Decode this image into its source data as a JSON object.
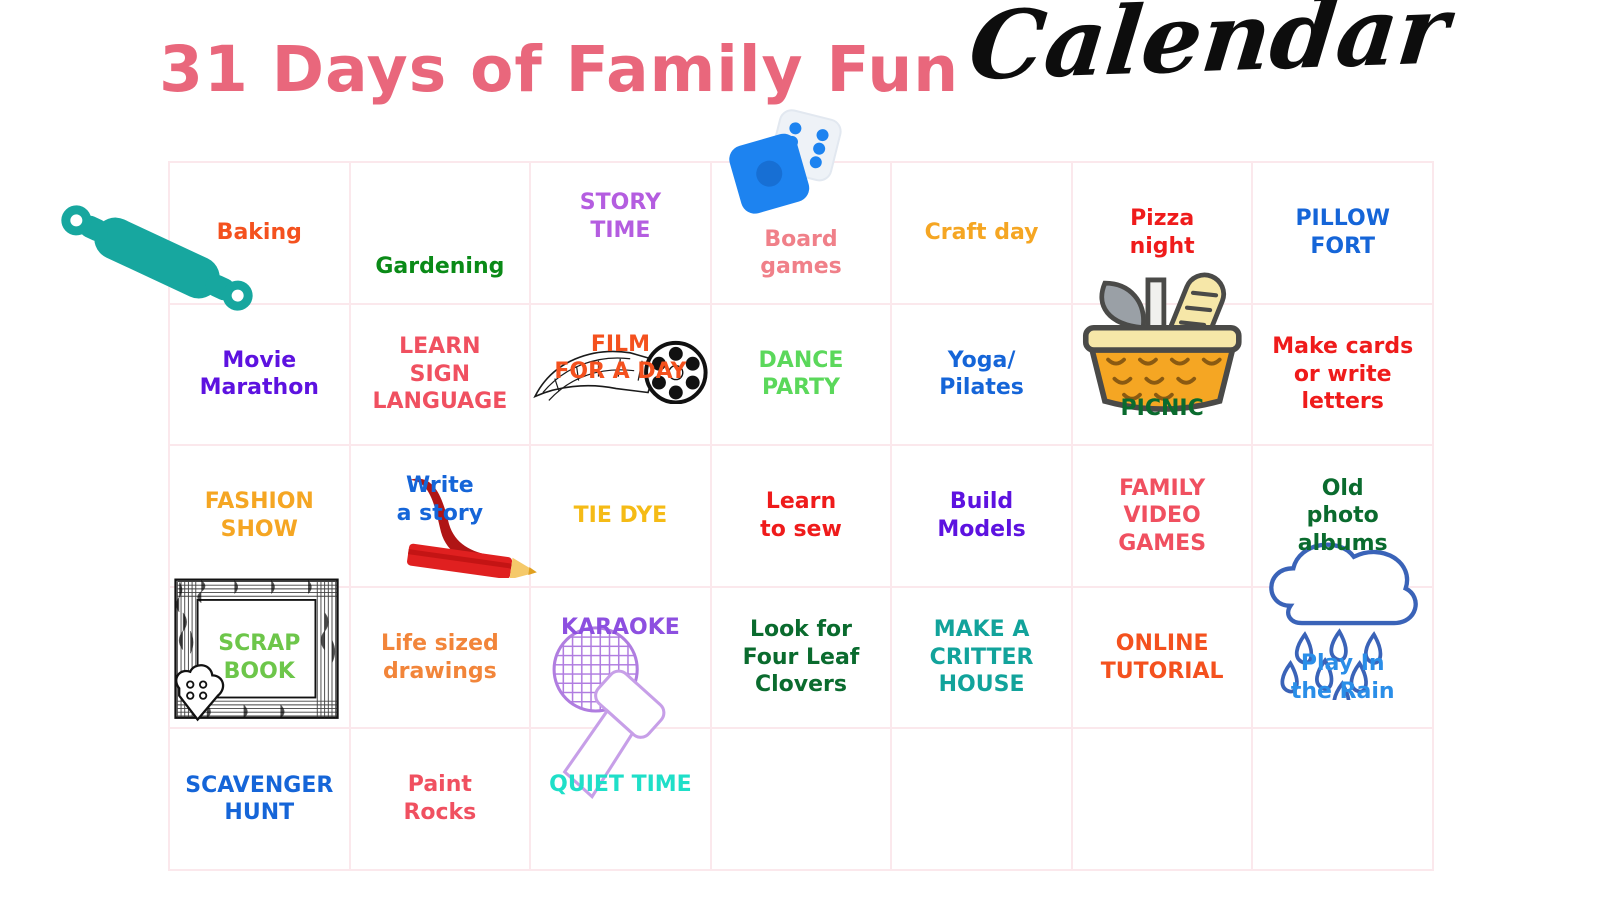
{
  "header": {
    "title_main": "31 Days of Family Fun",
    "title_script": "Calendar"
  },
  "colors": {
    "grid_line": "#fbe8ec",
    "title_pink": "#e9677c",
    "title_script_black": "#0d0d0d",
    "teal": "#17a79f",
    "dice_blue": "#1d83f0",
    "basket_orange": "#f5a623",
    "frame_ink": "#1a1a1a",
    "mic_purple": "#b07de0",
    "rain_blue": "#3a63b8",
    "pencil_red": "#d41c1c"
  },
  "calendar": {
    "columns": 7,
    "rows": 5,
    "cells": [
      {
        "label": "Baking",
        "color": "#f4511e",
        "align": "al-center",
        "icon": "rolling-pin-icon"
      },
      {
        "label": "Gardening",
        "color": "#0a8a17",
        "align": "al-bottom",
        "icon": null
      },
      {
        "label": "STORY\nTIME",
        "color": "#b45de0",
        "align": "al-top",
        "icon": null
      },
      {
        "label": "Board\ngames",
        "color": "#f08089",
        "align": "al-bottom",
        "icon": "dice-icon"
      },
      {
        "label": "Craft day",
        "color": "#f5a623",
        "align": "al-center",
        "icon": null
      },
      {
        "label": "Pizza\nnight",
        "color": "#ef1b1b",
        "align": "al-center",
        "icon": null
      },
      {
        "label": "PILLOW\nFORT",
        "color": "#1565d8",
        "align": "al-center",
        "icon": null
      },
      {
        "label": "Movie\nMarathon",
        "color": "#5d12e0",
        "align": "al-center",
        "icon": null
      },
      {
        "label": "LEARN\nSIGN\nLANGUAGE",
        "color": "#f05060",
        "align": "al-center",
        "icon": null
      },
      {
        "label": "FILM\nFOR A DAY",
        "color": "#f4511e",
        "align": "al-top",
        "icon": "film-reel-icon"
      },
      {
        "label": "DANCE\nPARTY",
        "color": "#5bd85b",
        "align": "al-center",
        "icon": null
      },
      {
        "label": "Yoga/\nPilates",
        "color": "#1565d8",
        "align": "al-center",
        "icon": null
      },
      {
        "label": "PICNIC",
        "color": "#0a6b2e",
        "align": "al-bottom",
        "icon": "picnic-basket-icon"
      },
      {
        "label": "Make cards\nor write\nletters",
        "color": "#ef1b1b",
        "align": "al-center",
        "icon": null
      },
      {
        "label": "FASHION\nSHOW",
        "color": "#f5a623",
        "align": "al-center",
        "icon": null
      },
      {
        "label": "Write\na story",
        "color": "#1565d8",
        "align": "al-top",
        "icon": "pencil-icon"
      },
      {
        "label": "TIE DYE",
        "color": "#f5bb16",
        "align": "al-center",
        "icon": null
      },
      {
        "label": "Learn\nto sew",
        "color": "#ef1b1b",
        "align": "al-center",
        "icon": null
      },
      {
        "label": "Build\nModels",
        "color": "#5d12e0",
        "align": "al-center",
        "icon": null
      },
      {
        "label": "FAMILY\nVIDEO\nGAMES",
        "color": "#f05060",
        "align": "al-center",
        "icon": null
      },
      {
        "label": "Old\nphoto\nalbums",
        "color": "#0a6b2e",
        "align": "al-center",
        "icon": null
      },
      {
        "label": "SCRAP\nBOOK",
        "color": "#6dc64a",
        "align": "al-center",
        "icon": "scrapbook-frame-icon"
      },
      {
        "label": "Life sized\ndrawings",
        "color": "#f2853a",
        "align": "al-center",
        "icon": null
      },
      {
        "label": "KARAOKE",
        "color": "#8d4fe0",
        "align": "al-top",
        "icon": "microphone-icon"
      },
      {
        "label": "Look for\nFour Leaf\nClovers",
        "color": "#0a6b2e",
        "align": "al-center",
        "icon": null
      },
      {
        "label": "MAKE A\nCRITTER\nHOUSE",
        "color": "#12a39b",
        "align": "al-center",
        "icon": null
      },
      {
        "label": "ONLINE\nTUTORIAL",
        "color": "#f4511e",
        "align": "al-center",
        "icon": null
      },
      {
        "label": "Play In\nthe Rain",
        "color": "#2a8ee8",
        "align": "al-bottom",
        "icon": "rain-cloud-icon"
      },
      {
        "label": "SCAVENGER\nHUNT",
        "color": "#1565d8",
        "align": "al-center",
        "icon": null
      },
      {
        "label": "Paint\nRocks",
        "color": "#f05060",
        "align": "al-upper",
        "icon": null
      },
      {
        "label": "QUIET TIME",
        "color": "#1fdfc8",
        "align": "al-upper",
        "icon": null
      },
      {
        "label": "",
        "color": "#000000",
        "align": "al-center",
        "icon": null
      },
      {
        "label": "",
        "color": "#000000",
        "align": "al-center",
        "icon": null
      },
      {
        "label": "",
        "color": "#000000",
        "align": "al-center",
        "icon": null
      },
      {
        "label": "",
        "color": "#000000",
        "align": "al-center",
        "icon": null
      }
    ]
  }
}
